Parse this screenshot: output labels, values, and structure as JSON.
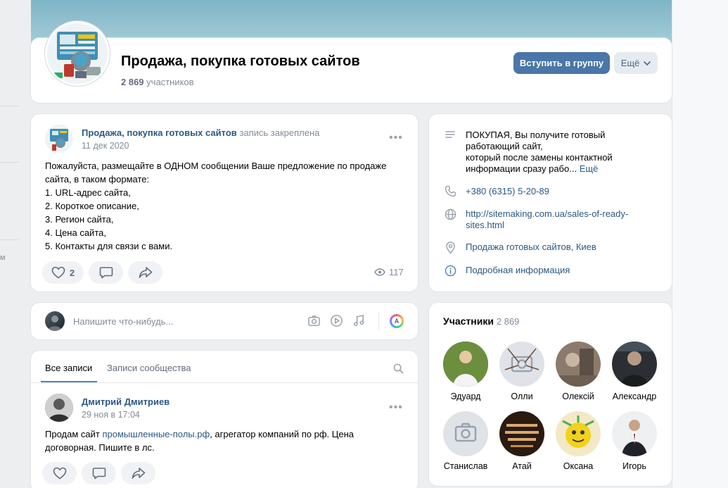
{
  "group": {
    "title": "Продажа, покупка готовых сайтов",
    "members_count": "2 869",
    "members_word": "участников",
    "join_label": "Вступить в группу",
    "more_label": "Ещё"
  },
  "pinned_post": {
    "author": "Продажа, покупка готовых сайтов",
    "pinned_note": "запись закреплена",
    "date": "11 дек 2020",
    "lines": [
      "Пожалуйста, размещайте в ОДНОМ сообщении Ваше предложение по продаже",
      "сайта, в таком формате:",
      "1. URL-адрес сайта,",
      "2. Короткое описание,",
      "3. Регион сайта,",
      "4. Цена сайта,",
      "5. Контакты для связи с вами."
    ],
    "likes": "2",
    "views": "117"
  },
  "composer": {
    "placeholder": "Напишите что-нибудь..."
  },
  "wall": {
    "tabs": [
      "Все записи",
      "Записи сообщества"
    ],
    "post": {
      "author": "Дмитрий Дмитриев",
      "date": "29 ноя в 17:04",
      "text_before": "Продам сайт ",
      "link": "промышленные-полы.рф",
      "text_after": ", агрегатор компаний по рф. Цена",
      "line2": "договорная. Пишите в лс."
    }
  },
  "info": {
    "description_lines": [
      "ПОКУПАЯ, Вы получите готовый",
      "работающий сайт,",
      "который после замены контактной"
    ],
    "description_last": "информации сразу рабо...",
    "description_more": "Ещё",
    "phone": "+380 (6315) 5-20-89",
    "website_line1": "http://sitemaking.com.ua/sales-of-ready-",
    "website_line2": "sites.html",
    "location": "Продажа готовых сайтов, Киев",
    "details": "Подробная информация"
  },
  "members_block": {
    "title": "Участники",
    "count": "2 869",
    "names": [
      "Эдуард",
      "Олли",
      "Олексій",
      "Александр",
      "Станислав",
      "Атай",
      "Оксана",
      "Игорь"
    ]
  },
  "colors": {
    "accent": "#4a76a8",
    "link": "#2a5885",
    "muted": "#818c99",
    "background": "#edeef0"
  },
  "icons": [
    "like-icon",
    "comment-icon",
    "share-icon",
    "eye-icon",
    "camera-icon",
    "video-icon",
    "music-icon",
    "ai-icon",
    "search-icon",
    "text-icon",
    "phone-icon",
    "globe-icon",
    "location-icon",
    "info-icon",
    "chevron-down-icon"
  ]
}
